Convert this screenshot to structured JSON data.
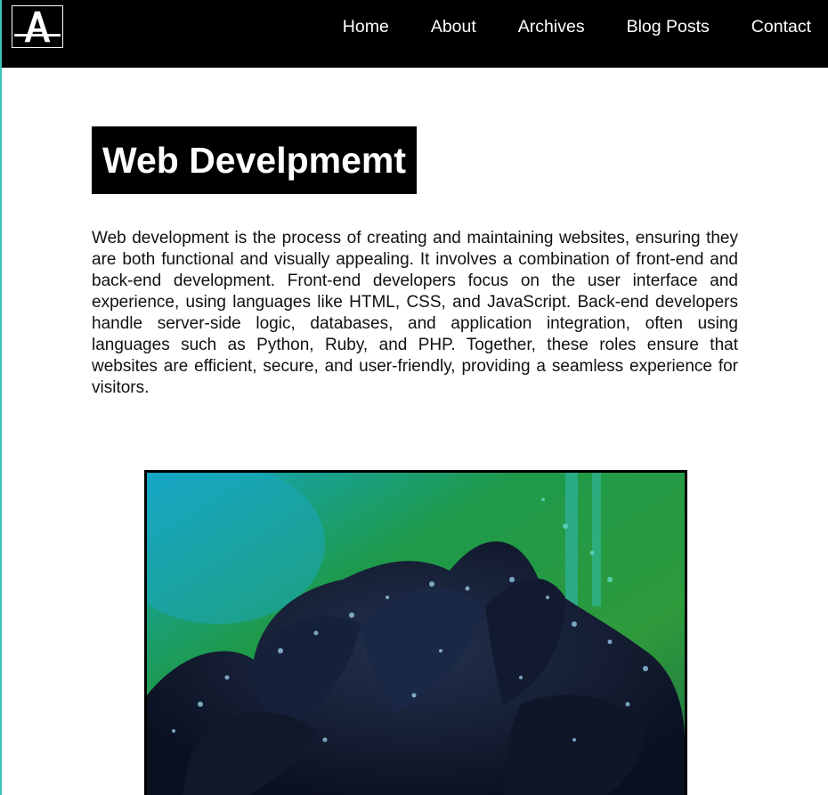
{
  "nav": {
    "logo_letter": "A",
    "links": [
      "Home",
      "About",
      "Archives",
      "Blog Posts",
      "Contact"
    ]
  },
  "main": {
    "title": "Web Develpmemt",
    "paragraph": "Web development is the process of creating and maintaining websites, ensuring they are both functional and visually appealing. It involves a combination of front-end and back-end development. Front-end developers focus on the user interface and experience, using languages like HTML, CSS, and JavaScript. Back-end developers handle server-side logic, databases, and application integration, often using languages such as Python, Ruby, and PHP. Together, these roles ensure that websites are efficient, secure, and user-friendly, providing a seamless experience for visitors."
  },
  "colors": {
    "navbar_bg": "#000000",
    "title_bg": "#000000",
    "accent_left_border": "#3cc3c0"
  },
  "image": {
    "subject_icon": "black-rose-photo"
  }
}
